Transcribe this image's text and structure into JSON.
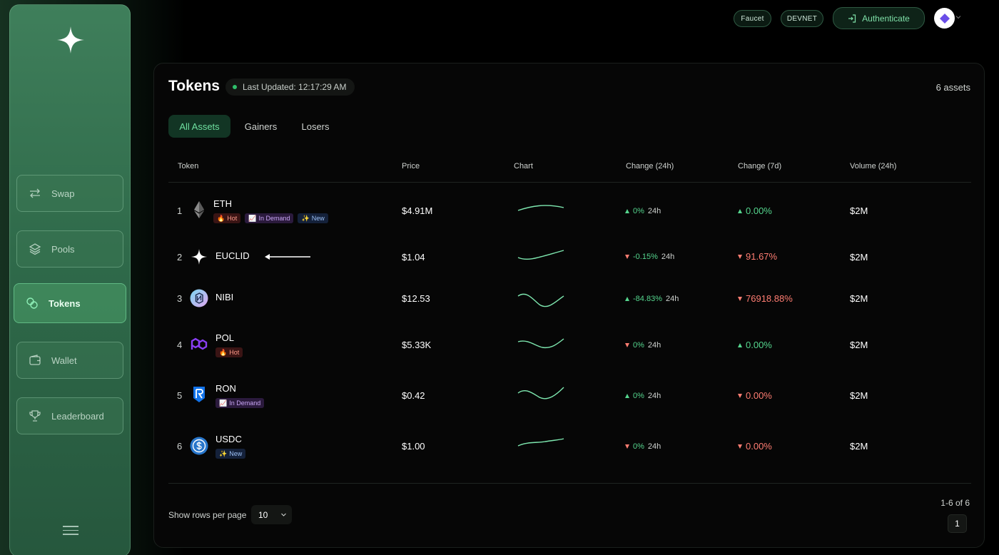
{
  "header": {
    "faucet_label": "Faucet",
    "network_label": "DEVNET",
    "auth_label": "Authenticate"
  },
  "sidebar": {
    "items": [
      {
        "label": "Swap",
        "icon": "swap-arrows-icon"
      },
      {
        "label": "Pools",
        "icon": "layers-icon"
      },
      {
        "label": "Tokens",
        "icon": "coins-icon",
        "active": true
      },
      {
        "label": "Wallet",
        "icon": "wallet-icon"
      },
      {
        "label": "Leaderboard",
        "icon": "trophy-icon"
      }
    ]
  },
  "page": {
    "title": "Tokens",
    "last_updated": "Last Updated: 12:17:29 AM",
    "asset_count": "6 assets"
  },
  "tabs": [
    "All Assets",
    "Gainers",
    "Losers"
  ],
  "table": {
    "columns": [
      "Token",
      "Price",
      "Chart",
      "Change (24h)",
      "Change (7d)",
      "Volume (24h)"
    ],
    "rows": [
      {
        "rank": "1",
        "name": "ETH",
        "badges": [
          {
            "type": "hot",
            "label": "Hot",
            "glyph": "🔥"
          },
          {
            "type": "demand",
            "label": "In Demand",
            "glyph": "📈"
          },
          {
            "type": "new",
            "label": "New",
            "glyph": "✨"
          }
        ],
        "price": "$4.91M",
        "change24_pct": "0%",
        "change24_unit": "24h",
        "change24_dir": "up",
        "change7": "0.00%",
        "change7_dir": "up",
        "volume": "$2M",
        "icon": "eth-icon"
      },
      {
        "rank": "2",
        "name": "EUCLID",
        "badges": [],
        "price": "$1.04",
        "change24_pct": "-0.15%",
        "change24_unit": "24h",
        "change24_dir": "down",
        "change7": "91.67%",
        "change7_dir": "down",
        "volume": "$2M",
        "icon": "euclid-icon"
      },
      {
        "rank": "3",
        "name": "NIBI",
        "badges": [],
        "price": "$12.53",
        "change24_pct": "-84.83%",
        "change24_unit": "24h",
        "change24_dir": "up",
        "change7": "76918.88%",
        "change7_dir": "down",
        "volume": "$2M",
        "icon": "nibi-icon"
      },
      {
        "rank": "4",
        "name": "POL",
        "badges": [
          {
            "type": "hot",
            "label": "Hot",
            "glyph": "🔥"
          }
        ],
        "price": "$5.33K",
        "change24_pct": "0%",
        "change24_unit": "24h",
        "change24_dir": "down",
        "change7": "0.00%",
        "change7_dir": "up",
        "volume": "$2M",
        "icon": "pol-icon"
      },
      {
        "rank": "5",
        "name": "RON",
        "badges": [
          {
            "type": "demand",
            "label": "In Demand",
            "glyph": "📈"
          }
        ],
        "price": "$0.42",
        "change24_pct": "0%",
        "change24_unit": "24h",
        "change24_dir": "up",
        "change7": "0.00%",
        "change7_dir": "down",
        "volume": "$2M",
        "icon": "ron-icon"
      },
      {
        "rank": "6",
        "name": "USDC",
        "badges": [
          {
            "type": "new",
            "label": "New",
            "glyph": "✨"
          }
        ],
        "price": "$1.00",
        "change24_pct": "0%",
        "change24_unit": "24h",
        "change24_dir": "down",
        "change7": "0.00%",
        "change7_dir": "down",
        "volume": "$2M",
        "icon": "usdc-icon"
      }
    ]
  },
  "footer": {
    "rows_label": "Show rows per page",
    "rows_value": "10",
    "range": "1-6 of 6",
    "page": "1"
  },
  "colors": {
    "accent": "#55d68e",
    "negative": "#ff7d72",
    "sidebar": "#2f6a4a"
  }
}
